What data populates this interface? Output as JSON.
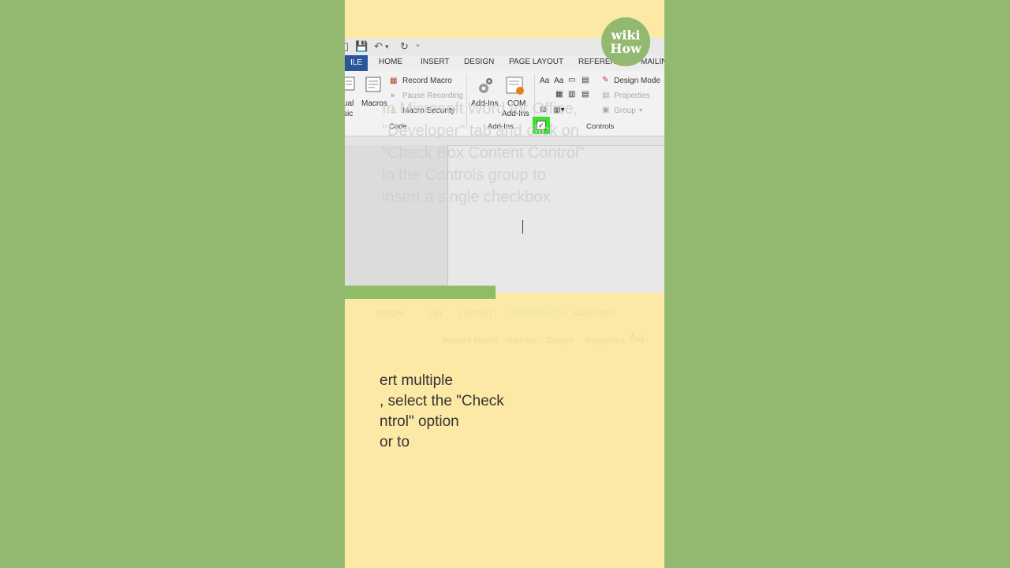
{
  "logo": {
    "line1": "wiki",
    "line2": "How"
  },
  "tabs": {
    "file": "ILE",
    "items": [
      "HOME",
      "INSERT",
      "DESIGN",
      "PAGE LAYOUT",
      "REFERENCES",
      "MAILIN"
    ]
  },
  "code_group": {
    "visual_basic_line1": "ual",
    "visual_basic_line2": "sic",
    "macros": "Macros",
    "record_macro": "Record Macro",
    "pause_recording": "Pause Recording",
    "macro_security": "Macro Security",
    "label": "Code"
  },
  "addins_group": {
    "addins": "Add-Ins",
    "com_line1": "COM",
    "com_line2": "Add-Ins",
    "label": "Add-Ins"
  },
  "controls_group": {
    "aa1": "Aa",
    "aa2": "Aa",
    "design_mode": "Design Mode",
    "properties": "Properties",
    "group": "Group",
    "label": "Controls"
  },
  "overlay_text": [
    "In Microsoft Word for Office,",
    "\"Developer\" tab and click on",
    "\"Check Box Content Control\"",
    "in the Controls group to",
    "insert a single checkbox"
  ],
  "faded_rows": {
    "row1": [
      "ESIGN",
      "LAY",
      "LAYOUT",
      "REFERENCES",
      "MAILINGS"
    ],
    "row2": [
      "Record Macro",
      "Add-Ins",
      "Design",
      "Properties",
      "Aa"
    ]
  },
  "caption_lines": [
    "ert multiple",
    ", select the \"Check",
    "ntrol\" option",
    "or to"
  ],
  "colors": {
    "accent_green": "#39e22c",
    "background": "#93b971",
    "panel": "#fce9a6",
    "file_tab": "#2b579a"
  }
}
